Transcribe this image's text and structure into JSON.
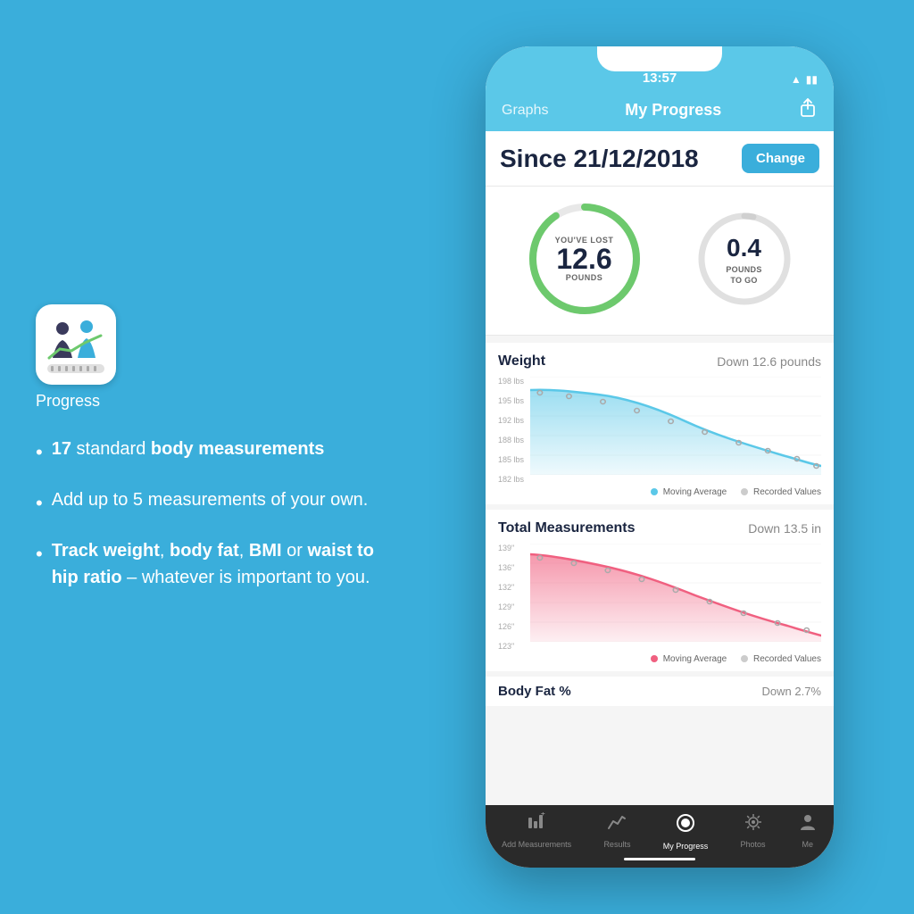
{
  "app": {
    "name": "Progress",
    "icon_alt": "Progress app icon"
  },
  "left_panel": {
    "bullets": [
      {
        "id": 1,
        "text_parts": [
          {
            "text": "17",
            "bold": true
          },
          {
            "text": " standard "
          },
          {
            "text": "body measurements",
            "bold": true
          }
        ],
        "display": "17 standard body measurements"
      },
      {
        "id": 2,
        "text_parts": [
          {
            "text": "Add up to 5 measurements of your own.",
            "bold": false
          }
        ],
        "display": "Add up to 5 measurements of your own."
      },
      {
        "id": 3,
        "text_parts": [
          {
            "text": "Track weight",
            "bold": true
          },
          {
            "text": ", "
          },
          {
            "text": "body fat",
            "bold": true
          },
          {
            "text": ", "
          },
          {
            "text": "BMI",
            "bold": true
          },
          {
            "text": " or "
          },
          {
            "text": "waist to hip ratio",
            "bold": true
          },
          {
            "text": " – whatever is important to you.",
            "bold": false
          }
        ],
        "display": "Track weight, body fat, BMI or waist to hip ratio – whatever is important to you."
      }
    ]
  },
  "phone": {
    "status_bar": {
      "time": "13:57"
    },
    "nav": {
      "graphs_label": "Graphs",
      "title": "My Progress",
      "share_icon": "↑"
    },
    "since_section": {
      "label": "Since 21/12/2018",
      "change_btn": "Change"
    },
    "big_circle": {
      "label_top": "YOU'VE LOST",
      "value": "12.6",
      "label_bottom": "POUNDS"
    },
    "small_circle": {
      "value": "0.4",
      "label_line1": "POUNDS",
      "label_line2": "TO GO"
    },
    "weight_chart": {
      "title": "Weight",
      "subtitle": "Down 12.6 pounds",
      "y_labels": [
        "198 lbs",
        "195 lbs",
        "192 lbs",
        "188 lbs",
        "185 lbs",
        "182 lbs"
      ],
      "legend_moving": "Moving Average",
      "legend_recorded": "Recorded Values",
      "color": "#5bc8e8"
    },
    "measurements_chart": {
      "title": "Total Measurements",
      "subtitle": "Down 13.5 in",
      "y_labels": [
        "139\"",
        "136\"",
        "132\"",
        "129\"",
        "126\"",
        "123\""
      ],
      "legend_moving": "Moving Average",
      "legend_recorded": "Recorded Values",
      "color": "#f06080"
    },
    "body_fat_section": {
      "title": "Body Fat %",
      "subtitle": "Down 2.7%"
    },
    "tab_bar": {
      "tabs": [
        {
          "id": "add",
          "label": "Add Measurements",
          "icon": "📊",
          "active": false
        },
        {
          "id": "results",
          "label": "Results",
          "icon": "📈",
          "active": false
        },
        {
          "id": "progress",
          "label": "My Progress",
          "icon": "◉",
          "active": true
        },
        {
          "id": "photos",
          "label": "Photos",
          "icon": "🌸",
          "active": false
        },
        {
          "id": "me",
          "label": "Me",
          "icon": "👤",
          "active": false
        }
      ]
    }
  },
  "colors": {
    "background": "#3aaedb",
    "nav_bar": "#5bc8e8",
    "green_circle": "#6dc96d",
    "gray_circle": "#cccccc",
    "weight_chart": "#5bc8e8",
    "measurements_chart": "#f06080",
    "change_btn": "#3aaedb",
    "tab_active": "#ffffff",
    "tab_inactive": "#888888"
  }
}
